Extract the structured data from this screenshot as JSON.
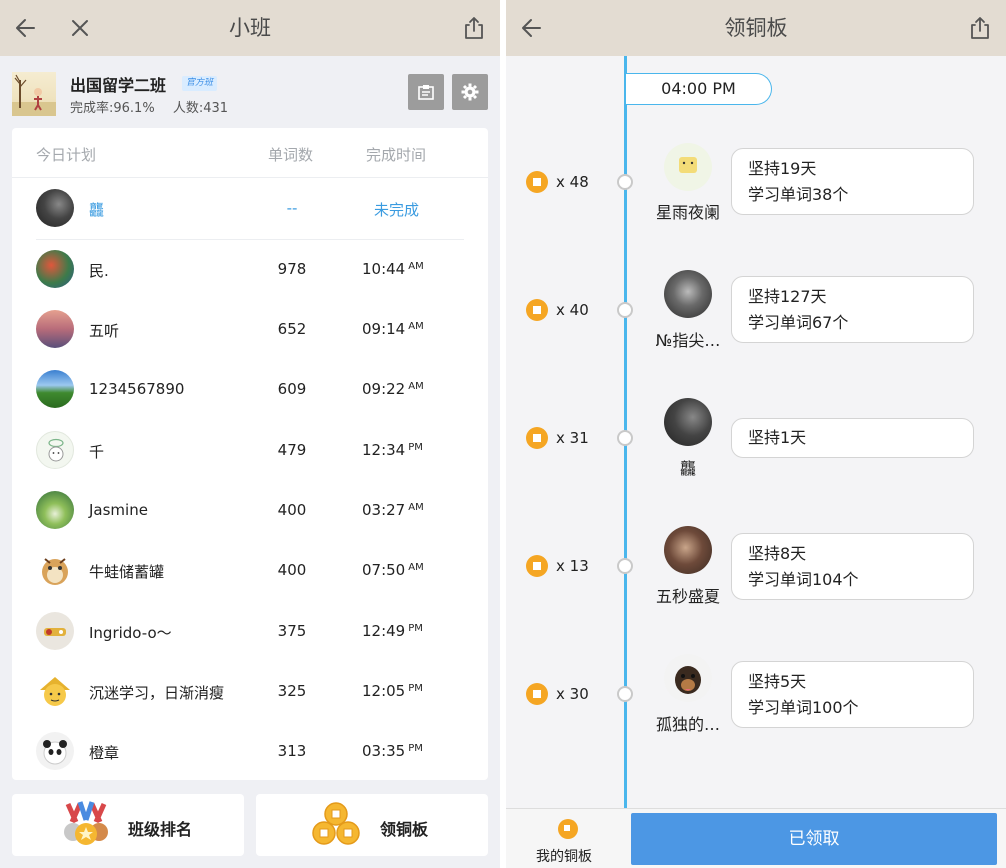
{
  "left": {
    "nav": {
      "title": "小班"
    },
    "class": {
      "name": "出国留学二班",
      "badge": "官方班",
      "completion": "完成率:96.1%",
      "members": "人数:431"
    },
    "plan": {
      "headers": {
        "plan": "今日计划",
        "words": "单词数",
        "time": "完成时间"
      },
      "rows": [
        {
          "name": "龘",
          "words": "--",
          "time": "未完成",
          "ampm": ""
        },
        {
          "name": "民.",
          "words": "978",
          "time": "10:44",
          "ampm": "AM"
        },
        {
          "name": "五听",
          "words": "652",
          "time": "09:14",
          "ampm": "AM"
        },
        {
          "name": "1234567890",
          "words": "609",
          "time": "09:22",
          "ampm": "AM"
        },
        {
          "name": "千",
          "words": "479",
          "time": "12:34",
          "ampm": "PM"
        },
        {
          "name": "Jasmine",
          "words": "400",
          "time": "03:27",
          "ampm": "AM"
        },
        {
          "name": "牛蛙储蓄罐",
          "words": "400",
          "time": "07:50",
          "ampm": "AM"
        },
        {
          "name": "Ingrido-o～",
          "words": "375",
          "time": "12:49",
          "ampm": "PM"
        },
        {
          "name": "沉迷学习，日渐消瘦",
          "words": "325",
          "time": "12:05",
          "ampm": "PM"
        },
        {
          "name": "橙章",
          "words": "313",
          "time": "03:35",
          "ampm": "PM"
        }
      ]
    },
    "buttons": {
      "rank": "班级排名",
      "copper": "领铜板"
    }
  },
  "right": {
    "nav": {
      "title": "领铜板"
    },
    "time_pill": "04:00 PM",
    "entries": [
      {
        "coins": "x 48",
        "name": "星雨夜阑",
        "line1": "坚持19天",
        "line2": "学习单词38个"
      },
      {
        "coins": "x 40",
        "name": "№指尖…",
        "line1": "坚持127天",
        "line2": "学习单词67个"
      },
      {
        "coins": "x 31",
        "name": "龘",
        "line1": "坚持1天",
        "line2": ""
      },
      {
        "coins": "x 13",
        "name": "五秒盛夏",
        "line1": "坚持8天",
        "line2": "学习单词104个"
      },
      {
        "coins": "x 30",
        "name": "孤独的…",
        "line1": "坚持5天",
        "line2": "学习单词100个"
      }
    ],
    "bottom": {
      "my_coins": "我的铜板",
      "claimed": "已领取"
    }
  },
  "colors": {
    "nav_bg": "#e3dcd2",
    "panel_bg": "#eff0f4",
    "accent_blue": "#3a9be0",
    "timeline_blue": "#4ab6ec",
    "coin_orange": "#f5a623",
    "button_blue": "#4c97e4"
  },
  "icons": [
    "back-arrow-icon",
    "close-icon",
    "share-icon",
    "clipboard-icon",
    "gear-icon",
    "medal-icon",
    "copper-coins-icon",
    "coin-icon"
  ]
}
